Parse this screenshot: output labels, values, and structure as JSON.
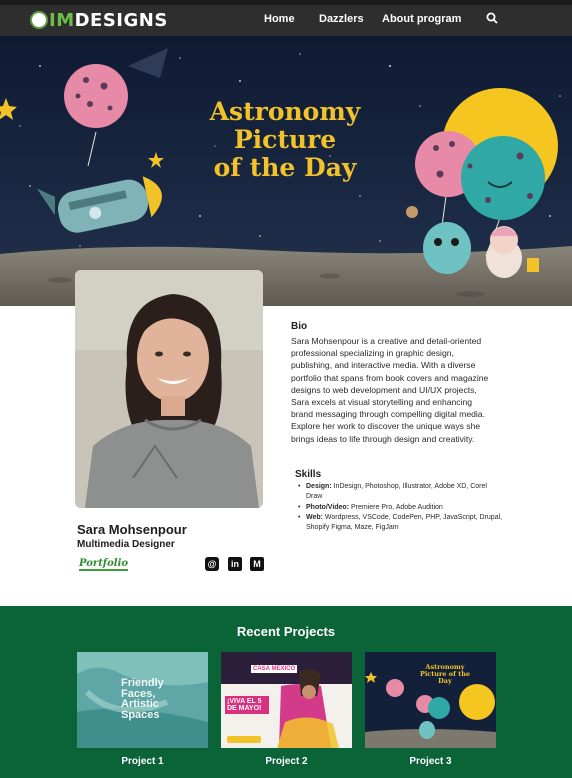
{
  "nav": {
    "logo_prefix": "IM",
    "logo_suffix": "DESIGNS",
    "links": [
      "Home",
      "Dazzlers",
      "About program"
    ],
    "search_icon": "search-icon"
  },
  "hero": {
    "title_lines": [
      "Astronomy",
      "Picture",
      "of the Day"
    ],
    "title_color": "#f2c329"
  },
  "profile": {
    "name": "Sara Mohsenpour",
    "role": "Multimedia Designer",
    "portfolio_label": "Portfolio",
    "social": [
      {
        "icon": "at-icon",
        "glyph": "@"
      },
      {
        "icon": "linkedin-icon",
        "glyph": "in"
      },
      {
        "icon": "medium-icon",
        "glyph": "M"
      }
    ]
  },
  "bio": {
    "title": "Bio",
    "text": "Sara Mohsenpour is a creative and detail-oriented professional specializing in graphic design, publishing, and interactive media. With a diverse portfolio that spans from book covers and magazine designs to web development and UI/UX projects, Sara excels at visual storytelling and enhancing brand messaging through compelling digital media. Explore her work to discover the unique ways she brings ideas to life through design and creativity."
  },
  "skills": {
    "title": "Skills",
    "items": [
      {
        "label": "Design:",
        "value": " InDesign, Photoshop, Illustrator, Adobe XD, Corel Draw"
      },
      {
        "label": "Photo/Video:",
        "value": " Premiere Pro, Adobe Audition"
      },
      {
        "label": "Web:",
        "value": "  Wordpress, VSCode, CodePen, PHP, JavaScript, Drupal, Shopify Figma, Maze, FigJam"
      }
    ]
  },
  "projects": {
    "title": "Recent Projects",
    "items": [
      {
        "label": "Project 1",
        "thumb_text": [
          "Friendly",
          "Faces,",
          "Artistic",
          "Spaces"
        ]
      },
      {
        "label": "Project 2",
        "thumb_logo": "CASA MEXICO",
        "thumb_badge": "¡VIVA EL 5 DE MAYO!"
      },
      {
        "label": "Project 3",
        "thumb_title": "Astronomy Picture of the Day"
      }
    ],
    "bg_color": "#0b6338"
  }
}
